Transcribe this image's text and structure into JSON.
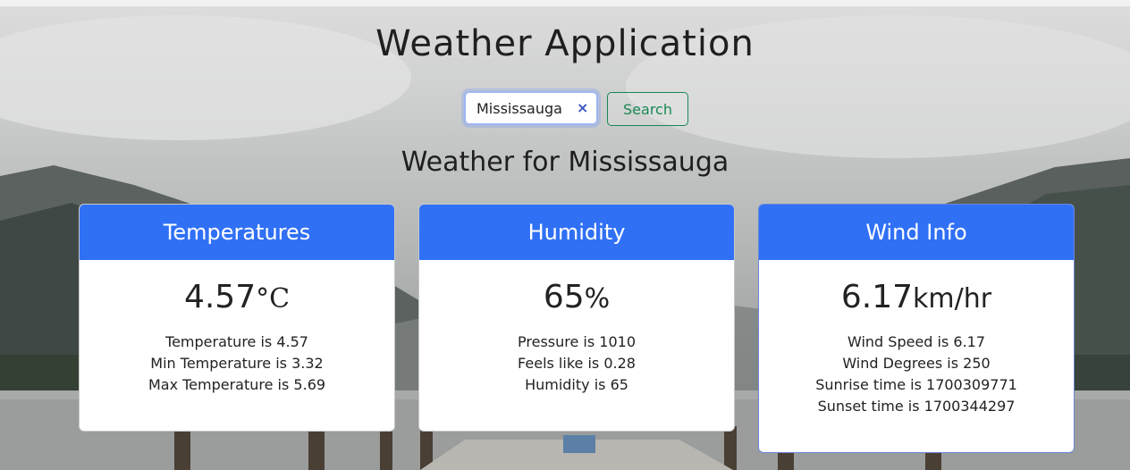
{
  "app": {
    "title": "Weather Application"
  },
  "search": {
    "value": "Mississauga",
    "clear_icon": "×",
    "button_label": "Search"
  },
  "heading": "Weather for Mississauga",
  "cards": {
    "temperatures": {
      "title": "Temperatures",
      "value": "4.57",
      "unit": "°C",
      "lines": [
        "Temperature is 4.57",
        "Min Temperature is 3.32",
        "Max Temperature is 5.69"
      ]
    },
    "humidity": {
      "title": "Humidity",
      "value": "65",
      "unit": "%",
      "lines": [
        "Pressure is 1010",
        "Feels like is 0.28",
        "Humidity is 65"
      ]
    },
    "wind": {
      "title": "Wind Info",
      "value": "6.17",
      "unit": "km/hr",
      "lines": [
        "Wind Speed is 6.17",
        "Wind Degrees is 250",
        "Sunrise time is 1700309771",
        "Sunset time is 1700344297"
      ]
    }
  },
  "colors": {
    "card_header": "#3070f5",
    "search_button": "#198754",
    "focus_ring": "#9fb6f1"
  },
  "icons": {
    "clear": "close-icon"
  }
}
